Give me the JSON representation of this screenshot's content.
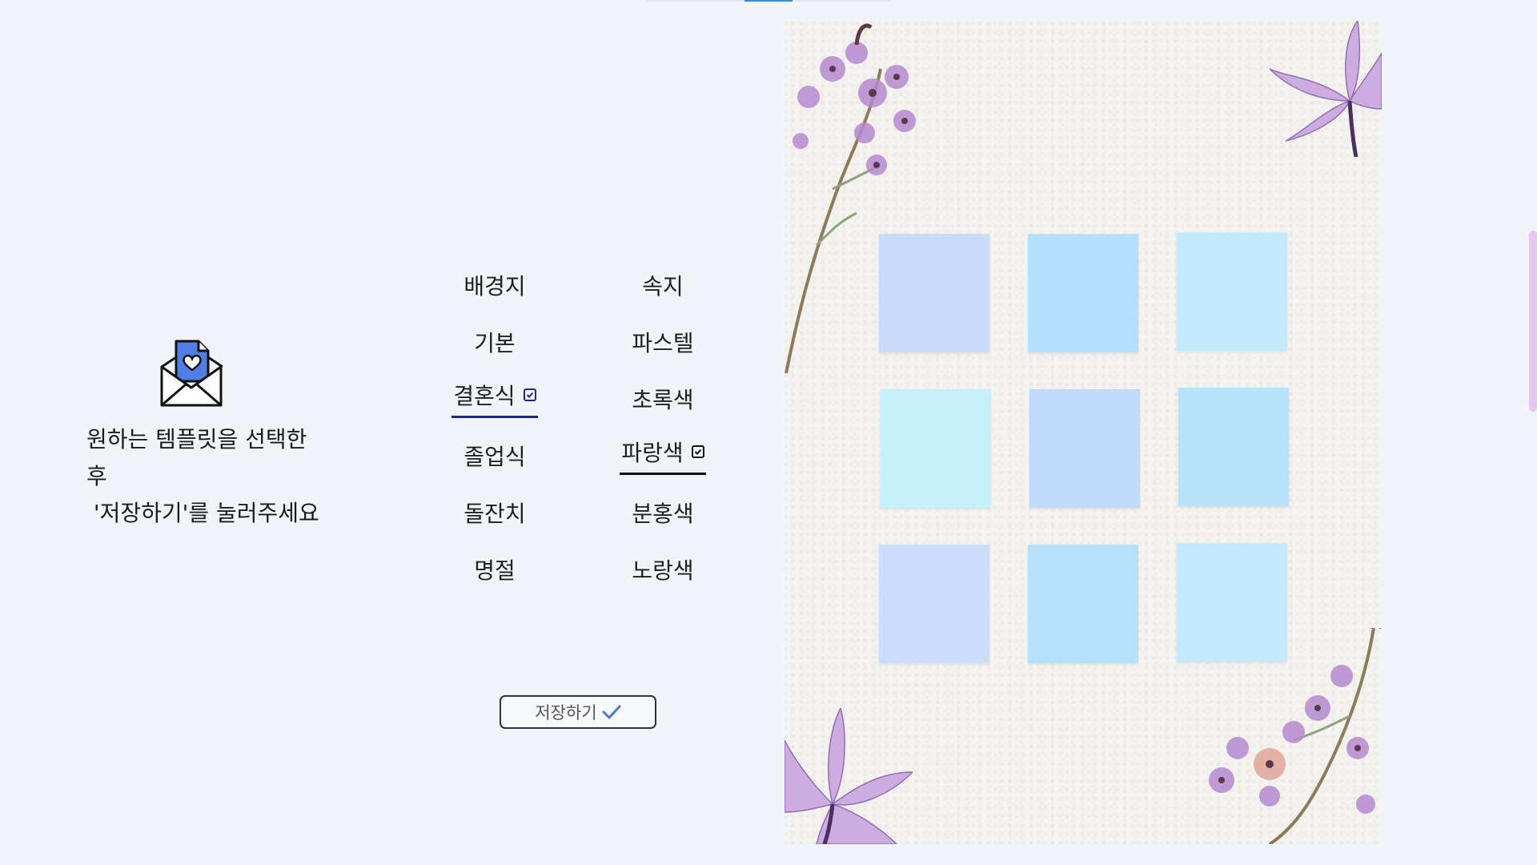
{
  "instruction": {
    "text": "원하는 템플릿을 선택한\n후\n '저장하기'를 눌러주세요",
    "icon": "envelope-heart-icon"
  },
  "menu": {
    "left": [
      {
        "label": "배경지",
        "selected": false
      },
      {
        "label": "기본",
        "selected": false
      },
      {
        "label": "결혼식",
        "selected": true
      },
      {
        "label": "졸업식",
        "selected": false
      },
      {
        "label": "돌잔치",
        "selected": false
      },
      {
        "label": "명절",
        "selected": false
      }
    ],
    "right": [
      {
        "label": "속지",
        "selected": false
      },
      {
        "label": "파스텔",
        "selected": false
      },
      {
        "label": "초록색",
        "selected": false
      },
      {
        "label": "파랑색",
        "selected": true
      },
      {
        "label": "분홍색",
        "selected": false
      },
      {
        "label": "노랑색",
        "selected": false
      }
    ]
  },
  "save_button": {
    "label": "저장하기",
    "icon": "checkmark-icon"
  },
  "colors": {
    "background": "#f1f4f8",
    "selected_underline_left": "#1e2a8a",
    "selected_underline_right": "#111111",
    "save_check": "#4b78d6",
    "scrollbar": "#e4c6f0",
    "sticky_colors": [
      "#cadcfc",
      "#b3e0fe",
      "#c2e9fc",
      "#c7f0fd",
      "#c1d9fb",
      "#b6e2fc",
      "#cbddfc",
      "#b5e1fd",
      "#c3e9fd"
    ]
  },
  "preview": {
    "theme": "watercolor-flowers",
    "sticky_note_count": 9
  }
}
